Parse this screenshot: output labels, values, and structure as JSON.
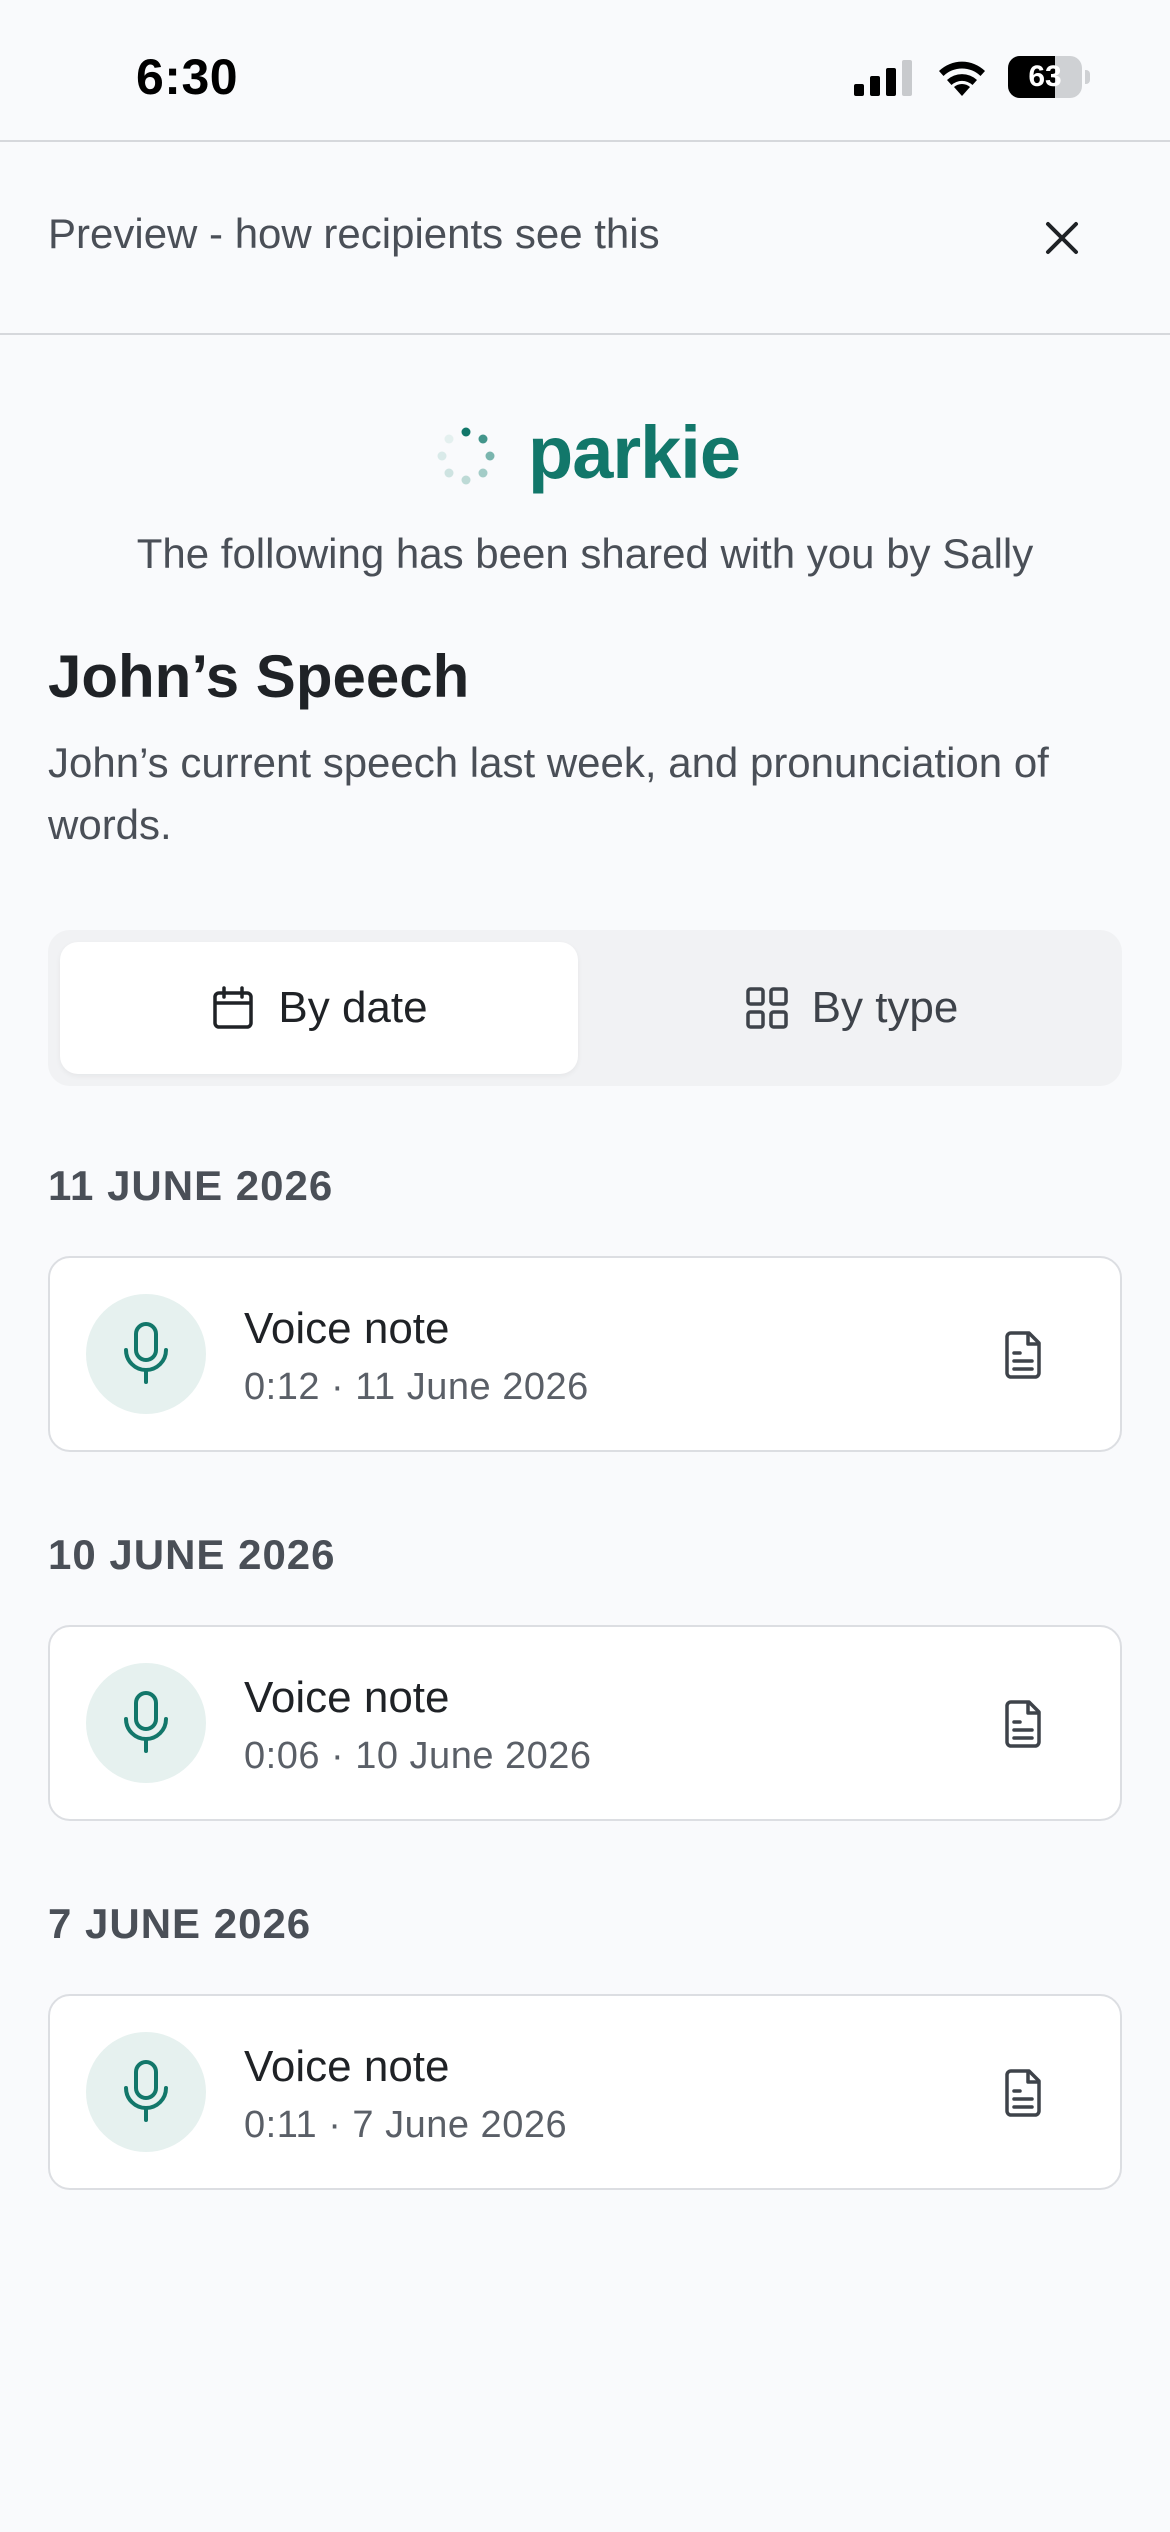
{
  "status_bar": {
    "time": "6:30",
    "battery_level": "63",
    "battery_fraction": 0.63
  },
  "preview": {
    "title": "Preview - how recipients see this",
    "close_icon": "close-icon"
  },
  "brand": {
    "name": "parkie",
    "color": "#12776a"
  },
  "shared_by_text": "The following has been shared with you by Sally",
  "collection": {
    "title": "John’s Speech",
    "description": "John’s current speech last week, and pronunciation of words."
  },
  "view_toggle": {
    "options": [
      {
        "label": "By date",
        "icon": "calendar-icon",
        "selected": true
      },
      {
        "label": "By type",
        "icon": "grid-icon",
        "selected": false
      }
    ]
  },
  "sections": [
    {
      "date_heading": "11 JUNE 2026",
      "items": [
        {
          "title": "Voice note",
          "meta": "0:12 · 11 June 2026",
          "icon": "microphone-icon",
          "action_icon": "document-icon"
        }
      ]
    },
    {
      "date_heading": "10 JUNE 2026",
      "items": [
        {
          "title": "Voice note",
          "meta": "0:06 · 10 June 2026",
          "icon": "microphone-icon",
          "action_icon": "document-icon"
        }
      ]
    },
    {
      "date_heading": "7 JUNE 2026",
      "items": [
        {
          "title": "Voice note",
          "meta": "0:11 · 7 June 2026",
          "icon": "microphone-icon",
          "action_icon": "document-icon"
        }
      ]
    }
  ],
  "colors": {
    "accent": "#12776a",
    "accent_light": "#e6f1ef",
    "background": "#f9fafc"
  }
}
